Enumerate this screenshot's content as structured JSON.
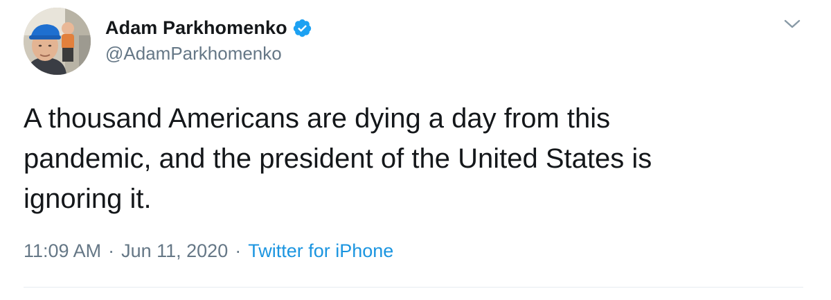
{
  "author": {
    "display_name": "Adam Parkhomenko",
    "handle": "@AdamParkhomenko",
    "verified": true,
    "avatar_icon": "profile-photo"
  },
  "tweet": {
    "text": "A thousand Americans are dying a day from this\npandemic, and the president of the United States is\nignoring it.",
    "time": "11:09 AM",
    "separator": "·",
    "date": "Jun 11, 2020",
    "source": "Twitter for iPhone"
  },
  "menu": {
    "icon": "chevron-down-icon"
  },
  "colors": {
    "text_primary": "#14171a",
    "text_secondary": "#657786",
    "link": "#1b95e0",
    "verified_badge": "#1da1f2",
    "divider": "#e6ecf0"
  }
}
